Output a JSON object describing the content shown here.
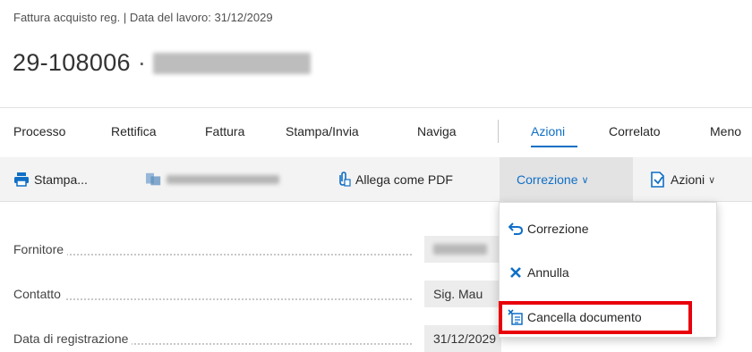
{
  "header": {
    "breadcrumb": "Fattura acquisto reg. | Data del lavoro: 31/12/2029",
    "doc_number": "29-108006",
    "separator": "·",
    "vendor_name_redacted": "Bochies calcbie S.p.A."
  },
  "menu": {
    "items": [
      "Processo",
      "Rettifica",
      "Fattura",
      "Stampa/Invia",
      "Naviga",
      "Azioni",
      "Correlato",
      "Meno"
    ],
    "active": "Azioni"
  },
  "actions": {
    "print_label": "Stampa...",
    "send_label_redacted": "Stampa allegato",
    "attach_pdf_label": "Allega come PDF",
    "correction_label": "Correzione",
    "actions_label": "Azioni"
  },
  "dropdown": {
    "items": [
      "Correzione",
      "Annulla",
      "Cancella documento"
    ],
    "highlighted": "Cancella documento"
  },
  "fields": {
    "vendor": {
      "label": "Fornitore",
      "value_redacted": "Bochies calcbie"
    },
    "contact": {
      "label": "Contatto",
      "value": "Sig. Mau"
    },
    "posting_date": {
      "label": "Data di registrazione",
      "value": "31/12/2029"
    }
  },
  "colors": {
    "accent": "#0f6fc6",
    "highlight": "#e8000b"
  }
}
